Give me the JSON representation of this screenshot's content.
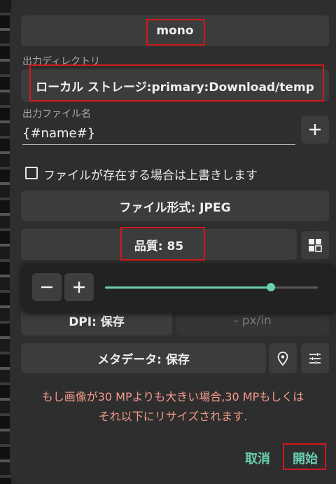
{
  "preset": {
    "label": "mono"
  },
  "output_dir": {
    "label": "出力ディレクトリ",
    "value": "ローカル ストレージ:primary:Download/temp"
  },
  "output_file": {
    "label": "出力ファイル名",
    "value": "{#name#}"
  },
  "overwrite": {
    "label": "ファイルが存在する場合は上書きします",
    "checked": false
  },
  "format_button": {
    "label": "ファイル形式: JPEG"
  },
  "quality_button": {
    "label": "品質: 85"
  },
  "quality_slider": {
    "level": 0.78
  },
  "dpi_button": {
    "label": "DPI: 保存"
  },
  "px_button": {
    "label": "- px/in"
  },
  "metadata_button": {
    "label": "メタデータ: 保存"
  },
  "warning": {
    "line1": "もし画像が30 MPよりも大きい場合,30 MPもしくは",
    "line2": "それ以下にリサイズされます."
  },
  "actions": {
    "cancel": "取消",
    "start": "開始"
  },
  "colors": {
    "accent": "#6bd0b3",
    "highlight": "#d1191c",
    "warning": "#f59a8b"
  },
  "icons": [
    "plus-icon",
    "grid-icon",
    "minus-icon",
    "plus-icon",
    "location-pin-icon",
    "tune-icon"
  ]
}
